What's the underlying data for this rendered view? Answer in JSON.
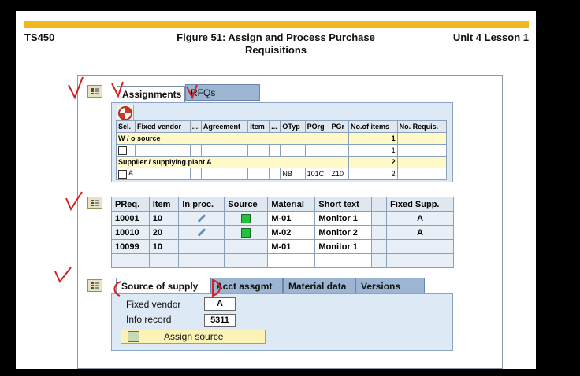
{
  "header": {
    "left": "TS450",
    "center_line1": "Figure 51: Assign and Process Purchase",
    "center_line2": "Requisitions",
    "right": "Unit 4 Lesson 1"
  },
  "tabs_top": [
    {
      "label": "Assignments"
    },
    {
      "label": "RFQs"
    }
  ],
  "assignments_table": {
    "headers": [
      "Sel.",
      "Fixed vendor",
      "...",
      "Agreement",
      "Item",
      "...",
      "OTyp",
      "POrg",
      "PGr",
      "No.of items",
      "No. Requis."
    ],
    "rows": [
      {
        "group": "W / o source",
        "count": "1"
      },
      {
        "vendor": "",
        "no_items": "1"
      },
      {
        "group": "Supplier / supplying plant A",
        "count": "2"
      },
      {
        "vendor": "A",
        "otyp": "NB",
        "porg": "101C",
        "pgr": "Z10",
        "no_items": "2"
      }
    ]
  },
  "preq_table": {
    "headers": [
      "PReq.",
      "Item",
      "In proc.",
      "Source",
      "Material",
      "Short text",
      "",
      "Fixed Supp."
    ],
    "rows": [
      {
        "preq": "10001",
        "item": "10",
        "material": "M-01",
        "text": "Monitor 1",
        "supp": "A"
      },
      {
        "preq": "10010",
        "item": "20",
        "material": "M-02",
        "text": "Monitor 2",
        "supp": "A"
      },
      {
        "preq": "10099",
        "item": "10",
        "material": "M-01",
        "text": "Monitor 1",
        "supp": ""
      }
    ]
  },
  "tabs_bottom": [
    {
      "label": "Source of supply"
    },
    {
      "label": "Acct assgmt"
    },
    {
      "label": "Material data"
    },
    {
      "label": "Versions"
    }
  ],
  "source": {
    "fixed_vendor_label": "Fixed vendor",
    "fixed_vendor_value": "A",
    "info_record_label": "Info record",
    "info_record_value": "5311",
    "assign_button": "Assign source"
  },
  "colors": {
    "accent_bar": "#f0b81c",
    "annotation": "#d62020"
  }
}
